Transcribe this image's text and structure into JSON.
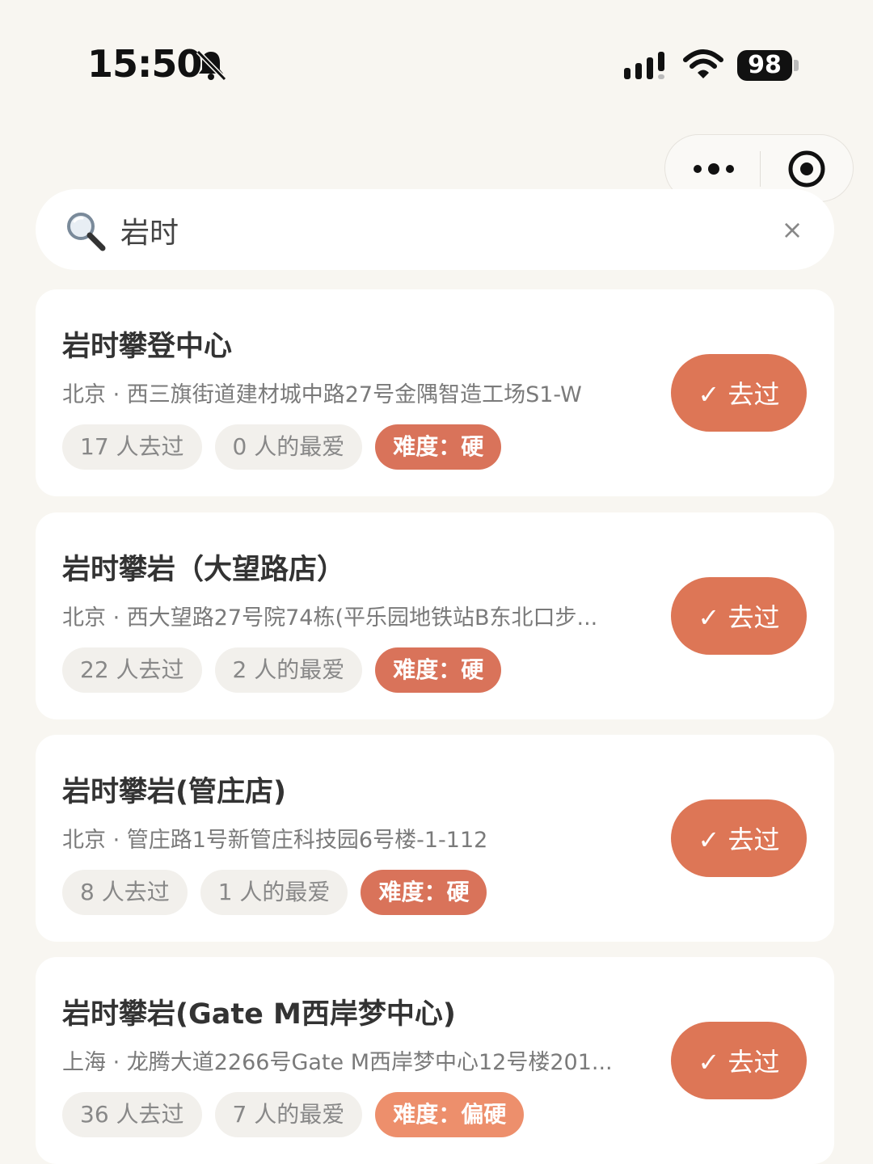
{
  "status_bar": {
    "time": "15:50",
    "battery": "98"
  },
  "search": {
    "value": "岩时",
    "clear_symbol": "×"
  },
  "results": [
    {
      "title": "岩时攀登中心",
      "address": "北京 · 西三旗街道建材城中路27号金隅智造工场S1-W",
      "visited": "17 人去过",
      "favorites": "0 人的最爱",
      "difficulty": "难度：硬",
      "button": "✓ 去过"
    },
    {
      "title": "岩时攀岩（大望路店）",
      "address": "北京 · 西大望路27号院74栋(平乐园地铁站B东北口步...",
      "visited": "22 人去过",
      "favorites": "2 人的最爱",
      "difficulty": "难度：硬",
      "button": "✓ 去过"
    },
    {
      "title": "岩时攀岩(管庄店)",
      "address": "北京 · 管庄路1号新管庄科技园6号楼-1-112",
      "visited": "8 人去过",
      "favorites": "1 人的最爱",
      "difficulty": "难度：硬",
      "button": "✓ 去过"
    },
    {
      "title": "岩时攀岩(Gate M西岸梦中心)",
      "address": "上海 · 龙腾大道2266号Gate M西岸梦中心12号楼201...",
      "visited": "36 人去过",
      "favorites": "7 人的最爱",
      "difficulty": "难度：偏硬",
      "button": "✓ 去过"
    }
  ],
  "colors": {
    "accent": "#dd7656",
    "difficulty_hard": "#d9735a",
    "difficulty_medium": "#ed8f6c",
    "background": "#f8f6f1"
  }
}
